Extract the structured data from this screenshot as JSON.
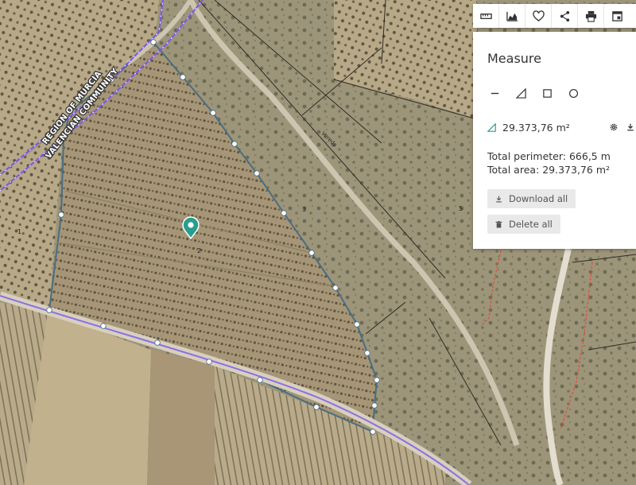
{
  "map": {
    "region_labels": [
      "REGION OF MURCIA",
      "VALENCIAN COMMUNITY"
    ],
    "road_label": "Vereda",
    "parcel_numbers": [
      "2",
      "3",
      "5",
      "1"
    ],
    "marker_icon": "map-pin-icon",
    "colors": {
      "polygon": "#4a6d80",
      "vertex": "#ffffff",
      "boundary": "#7b56e8",
      "marker": "#2a9d8f",
      "red_line": "#e04b3a"
    }
  },
  "toolbar": {
    "buttons": [
      {
        "name": "measure-icon"
      },
      {
        "name": "elevation-profile-icon"
      },
      {
        "name": "favorite-icon"
      },
      {
        "name": "share-icon"
      },
      {
        "name": "print-icon"
      },
      {
        "name": "window-icon"
      }
    ]
  },
  "panel": {
    "title": "Measure",
    "tools": [
      "line-tool-icon",
      "angle-tool-icon",
      "square-tool-icon",
      "circle-tool-icon"
    ],
    "result_value": "29.373,76 m²",
    "total_perimeter": "Total perimeter: 666,5 m",
    "total_area": "Total area: 29.373,76 m²",
    "download_all": "Download all",
    "delete_all": "Delete all"
  }
}
